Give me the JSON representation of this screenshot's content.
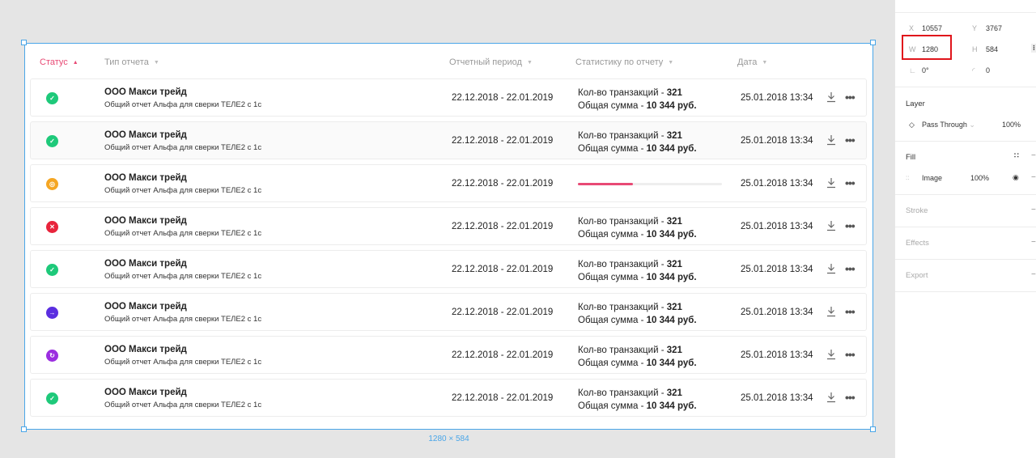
{
  "header": {
    "status": "Статус",
    "type": "Тип отчета",
    "period": "Отчетный период",
    "stats": "Статистику по отчету",
    "date": "Дата"
  },
  "rows": [
    {
      "status": "success",
      "company": "ООО Макси трейд",
      "desc": "Общий отчет Альфа для сверки ТЕЛЕ2 с 1с",
      "period": "22.12.2018 - 22.01.2019",
      "tx_label": "Кол-во транзакций - ",
      "tx_value": "321",
      "sum_label": "Общая сумма - ",
      "sum_value": "10 344 руб.",
      "date": "25.01.2018 13:34"
    },
    {
      "status": "success",
      "company": "ООО Макси трейд",
      "desc": "Общий отчет Альфа для сверки ТЕЛЕ2 с 1с",
      "period": "22.12.2018 - 22.01.2019",
      "tx_label": "Кол-во транзакций - ",
      "tx_value": "321",
      "sum_label": "Общая сумма - ",
      "sum_value": "10 344 руб.",
      "date": "25.01.2018 13:34"
    },
    {
      "status": "pending",
      "company": "ООО Макси трейд",
      "desc": "Общий отчет Альфа для сверки ТЕЛЕ2 с 1с",
      "period": "22.12.2018 - 22.01.2019",
      "progress": 0.38,
      "date": "25.01.2018 13:34"
    },
    {
      "status": "error",
      "company": "ООО Макси трейд",
      "desc": "Общий отчет Альфа для сверки ТЕЛЕ2 с 1с",
      "period": "22.12.2018 - 22.01.2019",
      "tx_label": "Кол-во транзакций - ",
      "tx_value": "321",
      "sum_label": "Общая сумма - ",
      "sum_value": "10 344 руб.",
      "date": "25.01.2018 13:34"
    },
    {
      "status": "success",
      "company": "ООО Макси трейд",
      "desc": "Общий отчет Альфа для сверки ТЕЛЕ2 с 1с",
      "period": "22.12.2018 - 22.01.2019",
      "tx_label": "Кол-во транзакций - ",
      "tx_value": "321",
      "sum_label": "Общая сумма - ",
      "sum_value": "10 344 руб.",
      "date": "25.01.2018 13:34"
    },
    {
      "status": "sent",
      "company": "ООО Макси трейд",
      "desc": "Общий отчет Альфа для сверки ТЕЛЕ2 с 1с",
      "period": "22.12.2018 - 22.01.2019",
      "tx_label": "Кол-во транзакций - ",
      "tx_value": "321",
      "sum_label": "Общая сумма - ",
      "sum_value": "10 344 руб.",
      "date": "25.01.2018 13:34"
    },
    {
      "status": "refresh",
      "company": "ООО Макси трейд",
      "desc": "Общий отчет Альфа для сверки ТЕЛЕ2 с 1с",
      "period": "22.12.2018 - 22.01.2019",
      "tx_label": "Кол-во транзакций - ",
      "tx_value": "321",
      "sum_label": "Общая сумма - ",
      "sum_value": "10 344 руб.",
      "date": "25.01.2018 13:34"
    },
    {
      "status": "success",
      "company": "ООО Макси трейд",
      "desc": "Общий отчет Альфа для сверки ТЕЛЕ2 с 1с",
      "period": "22.12.2018 - 22.01.2019",
      "tx_label": "Кол-во транзакций - ",
      "tx_value": "321",
      "sum_label": "Общая сумма - ",
      "sum_value": "10 344 руб.",
      "date": "25.01.2018 13:34"
    }
  ],
  "status_styles": {
    "success": {
      "color": "#1ec97a",
      "glyph": "✓"
    },
    "pending": {
      "color": "#f5a623",
      "glyph": "◎"
    },
    "error": {
      "color": "#e8243c",
      "glyph": "✕"
    },
    "sent": {
      "color": "#5b2ee0",
      "glyph": "→"
    },
    "refresh": {
      "color": "#9b2ee0",
      "glyph": "↻"
    }
  },
  "canvas": {
    "size_label": "1280 × 584"
  },
  "panel": {
    "x_label": "X",
    "x_value": "10557",
    "y_label": "Y",
    "y_value": "3767",
    "w_label": "W",
    "w_value": "1280",
    "h_label": "H",
    "h_value": "584",
    "rotation": "0°",
    "radius": "0",
    "layer_title": "Layer",
    "blend_mode": "Pass Through",
    "layer_opacity": "100%",
    "fill_title": "Fill",
    "fill_type": "Image",
    "fill_opacity": "100%",
    "stroke_title": "Stroke",
    "effects_title": "Effects",
    "export_title": "Export"
  },
  "colors": {
    "accent": "#e84a75",
    "selection": "#4aa6e8",
    "highlight": "#e0151b"
  }
}
